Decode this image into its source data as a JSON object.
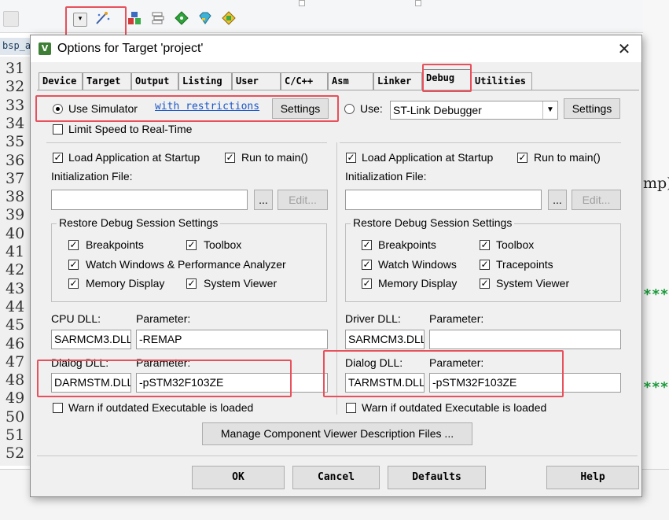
{
  "editor": {
    "file_tab": "bsp_a",
    "line_numbers": [
      "31",
      "32",
      "33",
      "34",
      "35",
      "36",
      "37",
      "38",
      "39",
      "40",
      "41",
      "42",
      "43",
      "44",
      "45",
      "46",
      "47",
      "48",
      "49",
      "50",
      "51",
      "52"
    ],
    "right_code_fragment": "mp)",
    "right_code_stars": "***"
  },
  "dialog": {
    "title": "Options for Target 'project'",
    "tabs": [
      "Device",
      "Target",
      "Output",
      "Listing",
      "User",
      "C/C++",
      "Asm",
      "Linker",
      "Debug",
      "Utilities"
    ],
    "active_tab": "Debug",
    "left": {
      "use_simulator_label": "Use Simulator",
      "restrictions_link": "with restrictions",
      "settings_button": "Settings",
      "limit_speed_label": "Limit Speed to Real-Time",
      "load_app_label": "Load Application at Startup",
      "run_to_main_label": "Run to main()",
      "init_file_label": "Initialization File:",
      "init_file_value": "",
      "browse_button": "...",
      "edit_button": "Edit...",
      "restore_group_title": "Restore Debug Session Settings",
      "restore_items": [
        "Breakpoints",
        "Toolbox",
        "Watch Windows & Performance Analyzer",
        "Memory Display",
        "System Viewer"
      ],
      "cpu_dll_label": "CPU DLL:",
      "parameter_label": "Parameter:",
      "cpu_dll_value": "SARMCM3.DLL",
      "cpu_param_value": "-REMAP",
      "dialog_dll_label": "Dialog DLL:",
      "dialog_dll_value": "DARMSTM.DLL",
      "dialog_param_value": "-pSTM32F103ZE",
      "warn_label": "Warn if outdated Executable is loaded"
    },
    "right": {
      "use_label": "Use:",
      "debugger_value": "ST-Link Debugger",
      "settings_button": "Settings",
      "load_app_label": "Load Application at Startup",
      "run_to_main_label": "Run to main()",
      "init_file_label": "Initialization File:",
      "init_file_value": "",
      "browse_button": "...",
      "edit_button": "Edit...",
      "restore_group_title": "Restore Debug Session Settings",
      "restore_items": [
        "Breakpoints",
        "Toolbox",
        "Watch Windows",
        "Tracepoints",
        "Memory Display",
        "System Viewer"
      ],
      "driver_dll_label": "Driver DLL:",
      "parameter_label": "Parameter:",
      "driver_dll_value": "SARMCM3.DLL",
      "driver_param_value": "",
      "dialog_dll_label": "Dialog DLL:",
      "dialog_dll_value": "TARMSTM.DLL",
      "dialog_param_value": "-pSTM32F103ZE",
      "warn_label": "Warn if outdated Executable is loaded"
    },
    "manage_button": "Manage Component Viewer Description Files ...",
    "ok_button": "OK",
    "cancel_button": "Cancel",
    "defaults_button": "Defaults",
    "help_button": "Help",
    "highlight_color": "#e8505b"
  }
}
